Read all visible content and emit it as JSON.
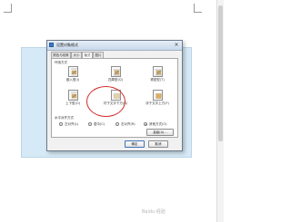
{
  "dialog": {
    "title": "设置对象格式",
    "close_glyph": "×",
    "tabs": [
      {
        "label": "颜色与线条"
      },
      {
        "label": "大小"
      },
      {
        "label": "版式"
      },
      {
        "label": "图片"
      }
    ],
    "active_tab": "版式",
    "wrap_section_label": "环绕方式",
    "wrap_options": [
      {
        "label": "嵌入型(I)",
        "selected": false
      },
      {
        "label": "四周型(Q)",
        "selected": false
      },
      {
        "label": "紧密型(T)",
        "selected": false
      },
      {
        "label": "上下型(O)",
        "selected": false
      },
      {
        "label": "衬于文字下方(B)",
        "selected": true
      },
      {
        "label": "浮于文字上方(F)",
        "selected": false
      }
    ],
    "align_section_label": "水平对齐方式",
    "align_options": [
      {
        "label": "左对齐(L)",
        "checked": false
      },
      {
        "label": "居中(C)",
        "checked": false
      },
      {
        "label": "右对齐(R)",
        "checked": false
      },
      {
        "label": "其他方式(O)",
        "checked": true
      }
    ],
    "advanced_button": "高级(A)...",
    "ok_button": "确定",
    "cancel_button": "取消"
  },
  "watermark": "Baidu 经验",
  "colors": {
    "highlight": "#d42a2a",
    "document_tint": "#d6e9f6",
    "icon_blue": "#3b7cc9",
    "icon_gold": "#e0b060"
  }
}
